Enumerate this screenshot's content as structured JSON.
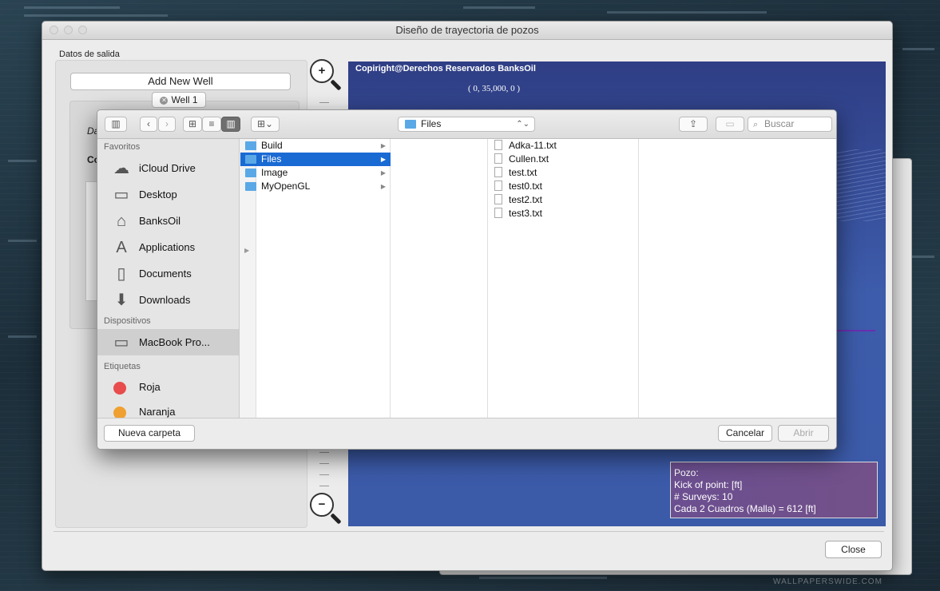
{
  "main_window": {
    "title": "Diseño de trayectoria de pozos",
    "section_label": "Datos de salida",
    "add_well_button": "Add New Well",
    "well_tab": "Well 1",
    "partial_label_da": "Da",
    "partial_label_co": "Co",
    "zoom_in": "+",
    "zoom_out": "−",
    "close_button": "Close"
  },
  "canvas": {
    "copyright": "Copiright@Derechos Reservados BanksOil",
    "coordinate": "( 0, 35,000, 0 )",
    "info": {
      "line1": "Pozo:",
      "line2": "Kick of point: [ft]",
      "line3": "# Surveys: 10",
      "line4": "Cada 2 Cuadros (Malla) = 612 [ft]"
    }
  },
  "dialog": {
    "location": "Files",
    "search_placeholder": "Buscar",
    "sidebar": {
      "favorites_header": "Favoritos",
      "favorites": [
        {
          "label": "iCloud Drive",
          "icon": "cloud-icon"
        },
        {
          "label": "Desktop",
          "icon": "desktop-icon"
        },
        {
          "label": "BanksOil",
          "icon": "home-icon"
        },
        {
          "label": "Applications",
          "icon": "applications-icon"
        },
        {
          "label": "Documents",
          "icon": "document-icon"
        },
        {
          "label": "Downloads",
          "icon": "download-icon"
        }
      ],
      "devices_header": "Dispositivos",
      "devices": [
        {
          "label": "MacBook Pro...",
          "icon": "laptop-icon"
        }
      ],
      "tags_header": "Etiquetas",
      "tags": [
        {
          "label": "Roja",
          "color": "#e84c4c"
        },
        {
          "label": "Naranja",
          "color": "#f0a030"
        }
      ]
    },
    "column1": [
      "Build",
      "Files",
      "Image",
      "MyOpenGL"
    ],
    "column1_selected": "Files",
    "column2": [
      "Adka-11.txt",
      "Cullen.txt",
      "test.txt",
      "test0.txt",
      "test2.txt",
      "test3.txt"
    ],
    "new_folder_button": "Nueva carpeta",
    "cancel_button": "Cancelar",
    "open_button": "Abrir"
  },
  "watermark": "WALLPAPERSWIDE.COM"
}
